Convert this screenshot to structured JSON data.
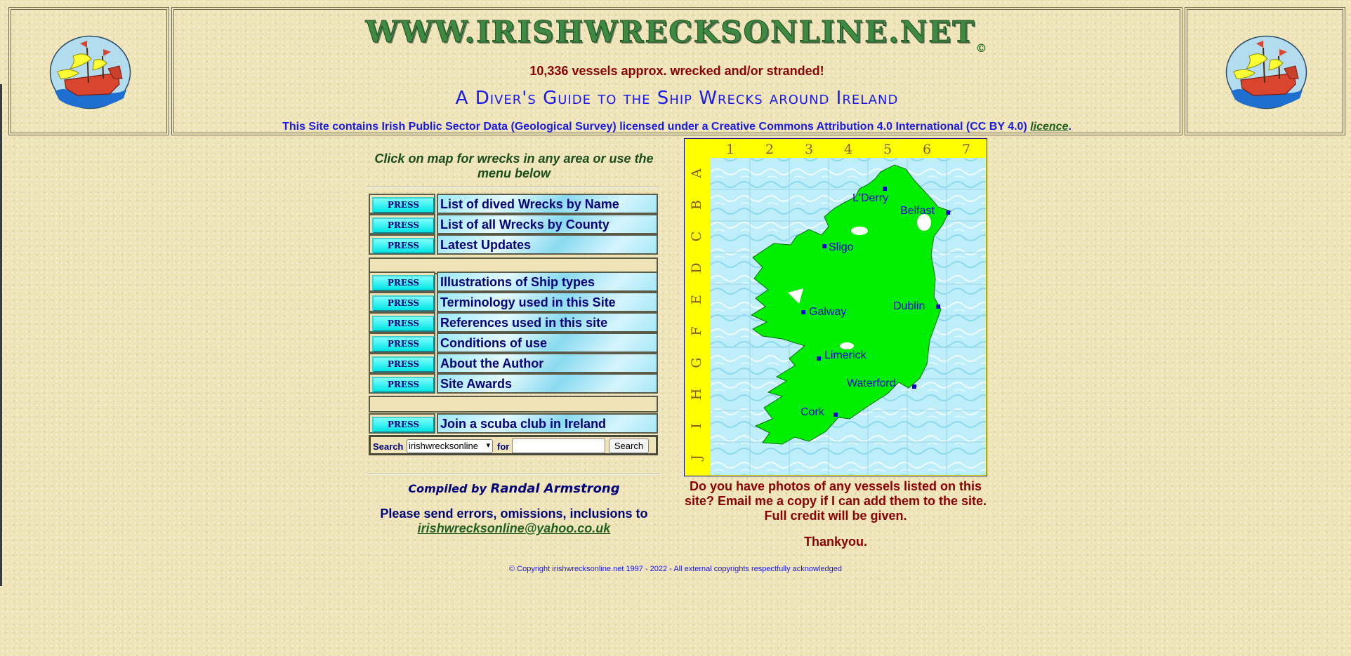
{
  "header": {
    "site_title": "WWW.IRISHWRECKSONLINE.NET",
    "copyright_mark": "©",
    "tagline": "10,336 vessels approx. wrecked and/or stranded!",
    "guide_title": "A Diver's Guide to the Ship Wrecks around Ireland",
    "license_text": "This Site contains Irish Public Sector Data (Geological Survey) licensed under a Creative Commons Attribution 4.0 International (CC BY 4.0) ",
    "license_link": "licence",
    "license_end": "."
  },
  "left": {
    "click_text": "Click on map for wrecks in any area or use the menu below",
    "press_label": "PRESS",
    "menu_group_1": [
      {
        "label": "List of dived Wrecks by Name"
      },
      {
        "label": "List of all Wrecks by County"
      },
      {
        "label": "Latest Updates"
      }
    ],
    "menu_group_2": [
      {
        "label": "Illustrations of Ship types"
      },
      {
        "label": "Terminology used in this Site"
      },
      {
        "label": "References used in this site"
      },
      {
        "label": "Conditions of use"
      },
      {
        "label": "About the Author"
      },
      {
        "label": "Site Awards"
      }
    ],
    "menu_group_3": [
      {
        "label": "Join a scuba club in Ireland"
      }
    ],
    "search": {
      "label": "Search",
      "selected": "irishwrecksonline",
      "for_label": "for",
      "button": "Search"
    },
    "compiled_by": "Compiled by",
    "author": "Randal Armstrong",
    "send_text": "Please send errors, omissions, inclusions to",
    "email": "irishwrecksonline@yahoo.co.uk"
  },
  "map": {
    "columns": [
      "1",
      "2",
      "3",
      "4",
      "5",
      "6",
      "7"
    ],
    "rows": [
      "A",
      "B",
      "C",
      "D",
      "E",
      "F",
      "G",
      "H",
      "I",
      "J"
    ],
    "cities": [
      "L'Derry",
      "Belfast",
      "Sligo",
      "Galway",
      "Dublin",
      "Limerick",
      "Waterford",
      "Cork"
    ],
    "colors": {
      "land": "#00ee00",
      "sea": "#bdeef9",
      "border": "#ffff00",
      "city": "#0000cc"
    }
  },
  "right": {
    "photos_text": "Do you have photos of any vessels listed on this site? Email me a copy if I can add them to the site. Full credit will be given.",
    "thanks": "Thankyou."
  },
  "footer": {
    "copyright": "© Copyright irishwrecksonline.net 1997 - 2022 - All external copyrights respectfully acknowledged"
  }
}
